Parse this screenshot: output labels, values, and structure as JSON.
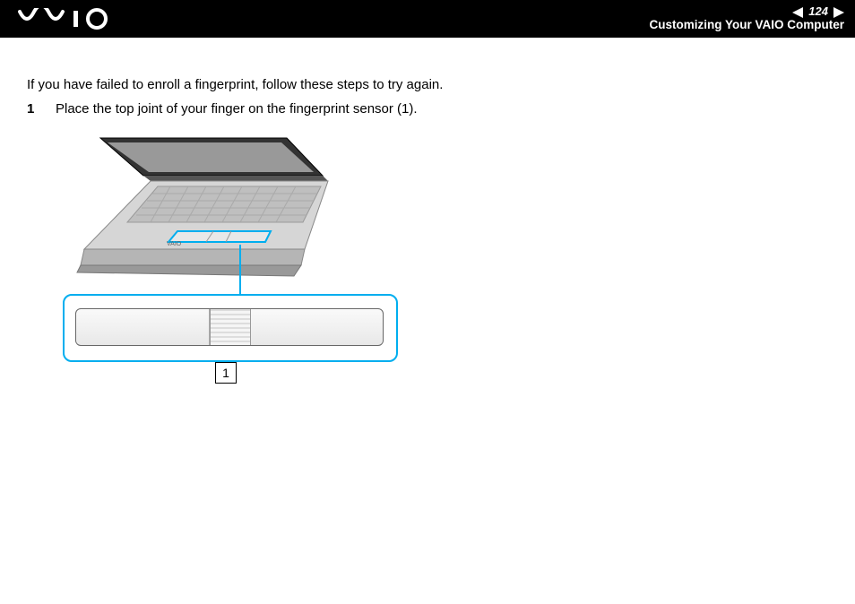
{
  "header": {
    "logo_alt": "VAIO",
    "page_number": "124",
    "section_title": "Customizing Your VAIO Computer"
  },
  "content": {
    "intro": "If you have failed to enroll a fingerprint, follow these steps to try again.",
    "step_number": "1",
    "step_text": "Place the top joint of your finger on the fingerprint sensor (1).",
    "callout_label": "1"
  }
}
